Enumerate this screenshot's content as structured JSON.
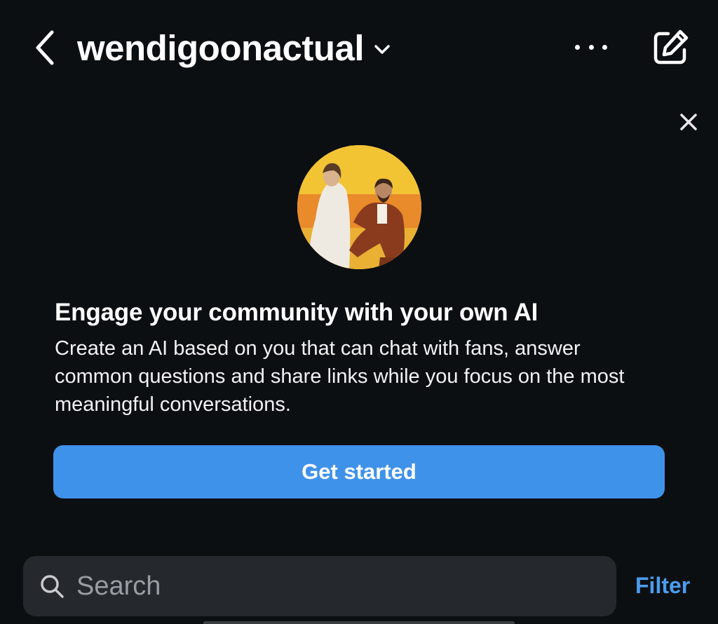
{
  "header": {
    "back_icon": "chevron-left-icon",
    "account_name": "wendigoonactual",
    "dropdown_icon": "chevron-down-icon",
    "more_icon": "more-horizontal-icon",
    "compose_icon": "compose-icon"
  },
  "promo": {
    "close_icon": "close-icon",
    "title": "Engage your community with your own AI",
    "body": "Create an AI based on you that can chat with fans, answer common questions and share links while you focus on the most meaningful conversations.",
    "cta_label": "Get started"
  },
  "search": {
    "icon": "search-icon",
    "placeholder": "Search",
    "value": ""
  },
  "filter_label": "Filter",
  "colors": {
    "background": "#0c0f12",
    "accent": "#3f92ea",
    "link": "#4a9df0",
    "search_bg": "#25282d"
  }
}
